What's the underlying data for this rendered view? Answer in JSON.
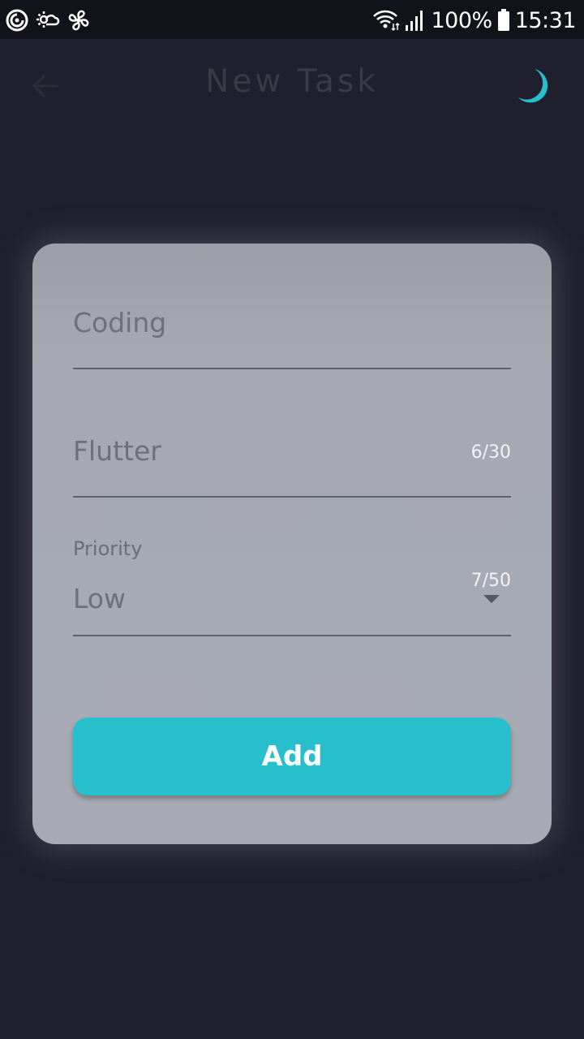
{
  "status_bar": {
    "battery": "100%",
    "time": "15:31",
    "left_icons": [
      "sync-icon",
      "weather-icon",
      "fan-icon"
    ],
    "right_icons": [
      "wifi-icon",
      "signal-icon",
      "battery-icon"
    ]
  },
  "app_bar": {
    "title": "New Task",
    "back_icon": "arrow-left-icon",
    "theme_icon": "moon-icon"
  },
  "form": {
    "title_field": {
      "value": "Coding",
      "counter": "6/30"
    },
    "description_field": {
      "value": "Flutter",
      "counter": "7/50"
    },
    "priority_field": {
      "label": "Priority",
      "selected": "Low"
    },
    "add_label": "Add"
  },
  "colors": {
    "background": "#1f1f2d",
    "status_bar": "#12121a",
    "card": "#a7aab4",
    "accent": "#27bfcb",
    "title_text": "#3a3a46"
  }
}
